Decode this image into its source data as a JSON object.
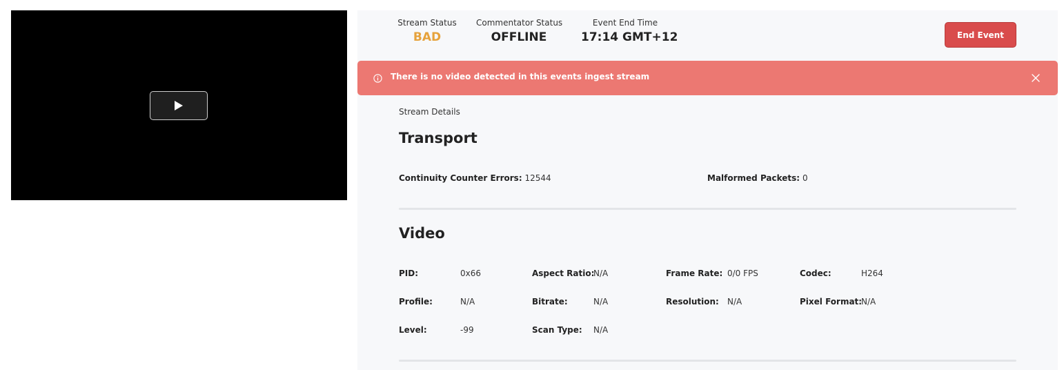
{
  "player": {
    "play_icon": "play-icon"
  },
  "status": {
    "stream_status_label": "Stream Status",
    "stream_status_value": "BAD",
    "commentator_status_label": "Commentator Status",
    "commentator_status_value": "OFFLINE",
    "event_end_label": "Event End Time",
    "event_end_value": "17:14 GMT+12",
    "end_event_button": "End Event",
    "bad_color": "#e6a23c"
  },
  "alert": {
    "message": "There is no video detected in this events ingest stream",
    "icon": "info-icon",
    "close_icon": "close-icon",
    "color": "#ec7872"
  },
  "details": {
    "caption": "Stream Details",
    "transport": {
      "heading": "Transport",
      "continuity_label": "Continuity Counter Errors:",
      "continuity_value": "12544",
      "malformed_label": "Malformed Packets:",
      "malformed_value": "0"
    },
    "video": {
      "heading": "Video",
      "pid_label": "PID:",
      "pid_value": "0x66",
      "aspect_label": "Aspect Ratio:",
      "aspect_value": "N/A",
      "framerate_label": "Frame Rate:",
      "framerate_value": "0/0 FPS",
      "codec_label": "Codec:",
      "codec_value": "H264",
      "profile_label": "Profile:",
      "profile_value": "N/A",
      "bitrate_label": "Bitrate:",
      "bitrate_value": "N/A",
      "resolution_label": "Resolution:",
      "resolution_value": "N/A",
      "pixfmt_label": "Pixel Format:",
      "pixfmt_value": "N/A",
      "level_label": "Level:",
      "level_value": "-99",
      "scantype_label": "Scan Type:",
      "scantype_value": "N/A"
    }
  }
}
